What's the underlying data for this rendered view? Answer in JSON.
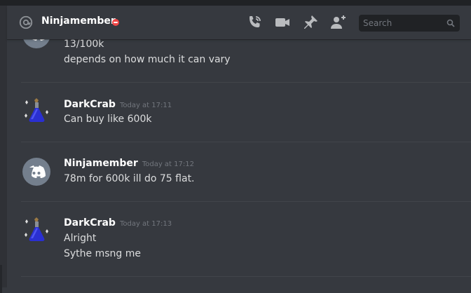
{
  "header": {
    "dm_name": "Ninjamember",
    "search_placeholder": "Search",
    "icons": [
      "at-icon",
      "dnd-status-icon",
      "call-icon",
      "video-icon",
      "pin-icon",
      "add-user-icon",
      "search-icon"
    ]
  },
  "messages": [
    {
      "author": "",
      "time": "",
      "avatar": "discord-default",
      "lines": [
        "13/100k",
        "depends on how much it can vary"
      ]
    },
    {
      "author": "DarkCrab",
      "time": "Today at 17:11",
      "avatar": "potion",
      "lines": [
        "Can buy like 600k"
      ]
    },
    {
      "author": "Ninjamember",
      "time": "Today at 17:12",
      "avatar": "discord-default",
      "lines": [
        "78m for 600k ill do 75 flat."
      ]
    },
    {
      "author": "DarkCrab",
      "time": "Today at 17:13",
      "avatar": "potion",
      "lines": [
        "Alright",
        "Sythe msng me"
      ]
    }
  ],
  "colors": {
    "background": "#36393f",
    "header_text": "#ffffff",
    "dnd": "#f04747",
    "timestamp": "#72767d",
    "message_text": "#dcddde"
  }
}
